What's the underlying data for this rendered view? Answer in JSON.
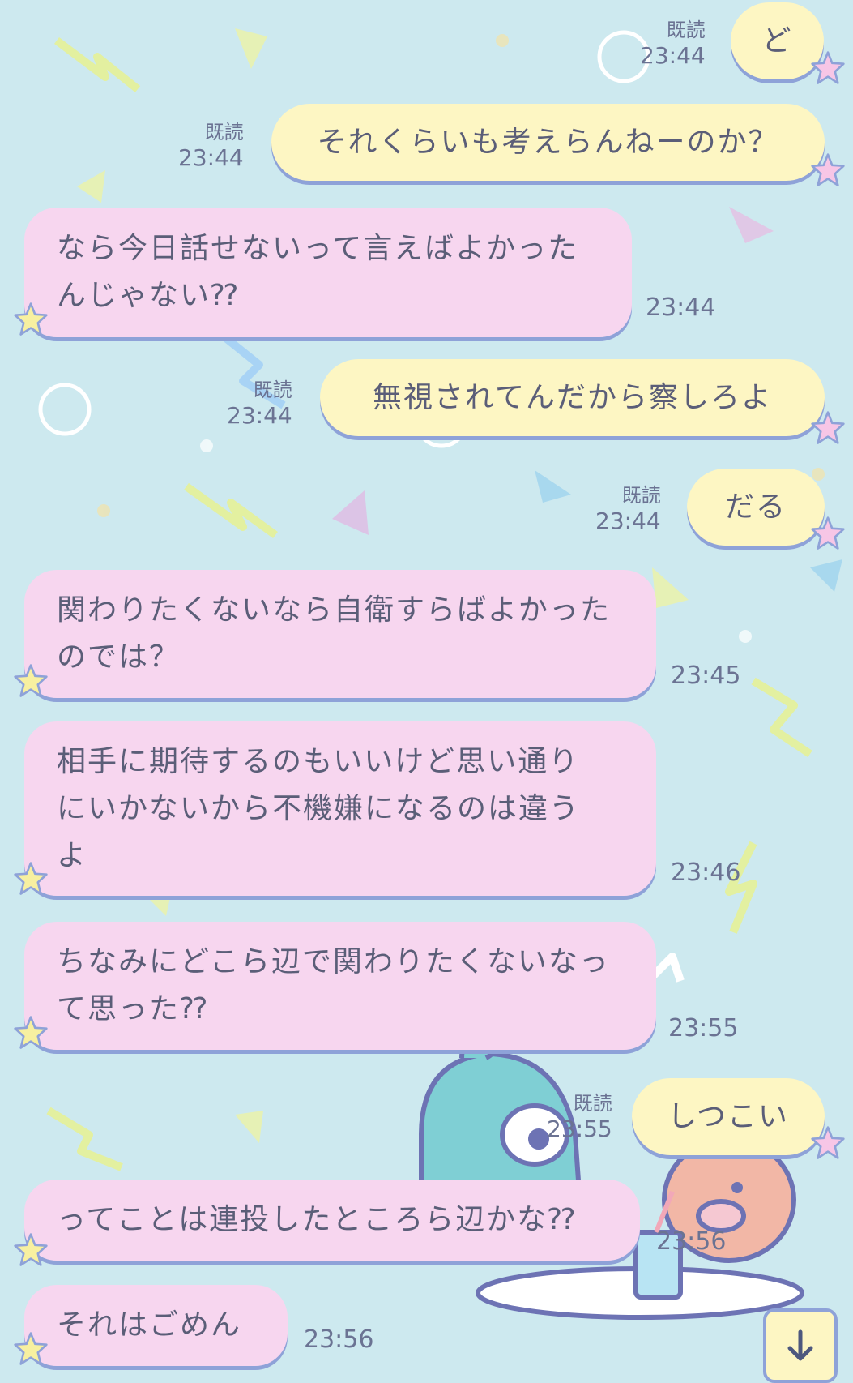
{
  "chat": {
    "messages": [
      {
        "id": "m1",
        "side": "me",
        "lines": [
          "ど"
        ],
        "read": "既読",
        "time": "23:44"
      },
      {
        "id": "m2",
        "side": "me",
        "lines": [
          "それくらいも考えらんねーのか？"
        ],
        "read": "既読",
        "time": "23:44"
      },
      {
        "id": "m3",
        "side": "them",
        "lines": [
          "なら今日話せないって言えばよかった",
          "んじゃない⁇"
        ],
        "time": "23:44"
      },
      {
        "id": "m4",
        "side": "me",
        "lines": [
          "無視されてんだから察しろよ"
        ],
        "read": "既読",
        "time": "23:44"
      },
      {
        "id": "m5",
        "side": "me",
        "lines": [
          "だる"
        ],
        "read": "既読",
        "time": "23:44"
      },
      {
        "id": "m6",
        "side": "them",
        "lines": [
          "関わりたくないなら自衛すらばよかった",
          "のでは？"
        ],
        "time": "23:45"
      },
      {
        "id": "m7",
        "side": "them",
        "lines": [
          "相手に期待するのもいいけど思い通り",
          "にいかないから不機嫌になるのは違う",
          "よ"
        ],
        "time": "23:46"
      },
      {
        "id": "m8",
        "side": "them",
        "lines": [
          "ちなみにどこら辺で関わりたくないなっ",
          "て思った⁇"
        ],
        "time": "23:55"
      },
      {
        "id": "m9",
        "side": "me",
        "lines": [
          "しつこい"
        ],
        "read": "既読",
        "time": "23:55"
      },
      {
        "id": "m10",
        "side": "them",
        "lines": [
          "ってことは連投したところら辺かな⁇"
        ],
        "time": "23:56"
      },
      {
        "id": "m11",
        "side": "them",
        "lines": [
          "それはごめん"
        ],
        "time": "23:56"
      }
    ]
  },
  "controls": {
    "scroll_down_icon": "arrow-down-icon"
  },
  "colors": {
    "background": "#cde9ef",
    "my_bubble": "#fdf6c3",
    "their_bubble": "#f7d6ef",
    "outline": "#8ea2d8",
    "text": "#5b5e78"
  }
}
